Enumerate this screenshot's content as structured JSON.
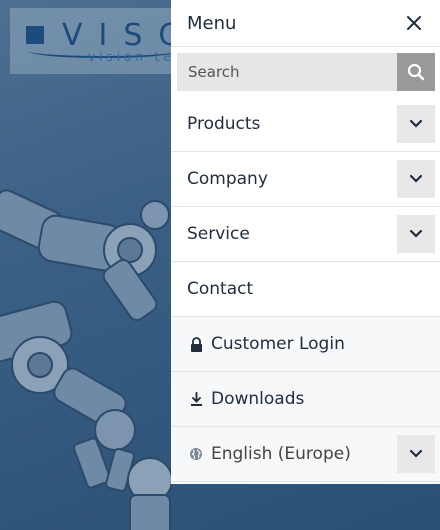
{
  "background": {
    "logo_text": "VISC",
    "logo_sub": "vision te"
  },
  "menu": {
    "title": "Menu",
    "search": {
      "placeholder": "Search"
    },
    "items": [
      {
        "label": "Products",
        "icon": "",
        "has_chevron": true
      },
      {
        "label": "Company",
        "icon": "",
        "has_chevron": true
      },
      {
        "label": "Service",
        "icon": "",
        "has_chevron": true
      },
      {
        "label": "Contact",
        "icon": "",
        "has_chevron": false
      },
      {
        "label": "Customer Login",
        "icon": "lock-icon",
        "has_chevron": false
      },
      {
        "label": "Downloads",
        "icon": "download-icon",
        "has_chevron": false
      },
      {
        "label": "English (Europe)",
        "icon": "globe-icon",
        "has_chevron": true
      }
    ]
  },
  "colors": {
    "panel_bg": "#ffffff",
    "text": "#1f2d3d",
    "chevron_bg": "#e8e8e8",
    "search_bg": "#e6e6e6",
    "search_button": "#9a9a9a",
    "overlay": "#2f5478"
  }
}
